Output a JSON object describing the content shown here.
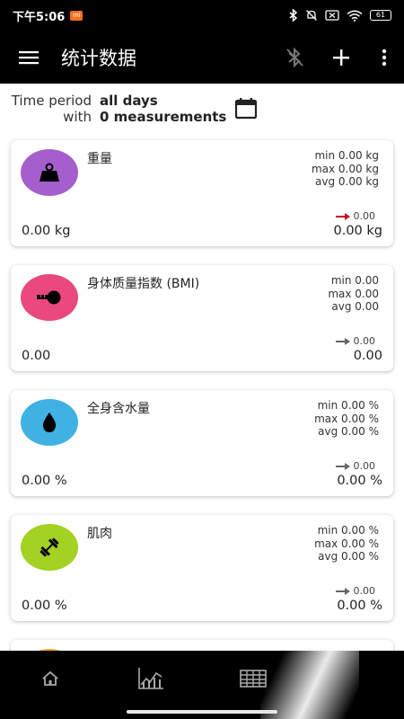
{
  "status_bar": {
    "time": "下午5:06",
    "battery": "61"
  },
  "app_bar": {
    "title": "统计数据"
  },
  "period": {
    "time_label": "Time period",
    "time_value": "all days",
    "with_label": "with",
    "with_value": "0 measurements"
  },
  "colors": {
    "weight": "#a45fcd",
    "bmi": "#ea4980",
    "water": "#3fb2e3",
    "muscle": "#a3d124",
    "diff_red": "#d0021b",
    "diff_gray": "#666666"
  },
  "cards": [
    {
      "name": "重量",
      "min": "min 0.00 kg",
      "max": "max 0.00 kg",
      "avg": "avg 0.00 kg",
      "diff": "0.00",
      "left_value": "0.00 kg",
      "right_value": "0.00 kg",
      "icon": "weight-icon"
    },
    {
      "name": "身体质量指数 (BMI)",
      "min": "min 0.00",
      "max": "max 0.00",
      "avg": "avg 0.00",
      "diff": "0.00",
      "left_value": "0.00",
      "right_value": "0.00",
      "icon": "tape-measure-icon"
    },
    {
      "name": "全身含水量",
      "min": "min 0.00 %",
      "max": "max 0.00 %",
      "avg": "avg 0.00 %",
      "diff": "0.00",
      "left_value": "0.00 %",
      "right_value": "0.00 %",
      "icon": "water-drop-icon"
    },
    {
      "name": "肌肉",
      "min": "min 0.00 %",
      "max": "max 0.00 %",
      "avg": "avg 0.00 %",
      "diff": "0.00",
      "left_value": "0.00 %",
      "right_value": "0.00 %",
      "icon": "dumbbell-icon"
    }
  ]
}
